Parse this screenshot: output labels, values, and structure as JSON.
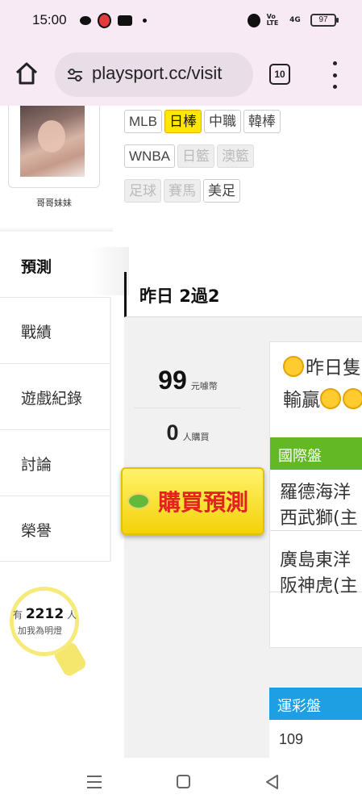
{
  "status_bar": {
    "time": "15:00",
    "volte": "Vo LTE",
    "signal": "4G",
    "battery": "97",
    "icons": [
      "message-icon",
      "app-icon",
      "youtube-icon",
      "dot-icon",
      "alarm-icon",
      "volte-icon",
      "signal-icon",
      "battery-icon"
    ]
  },
  "browser": {
    "url": "playsport.cc/visit",
    "tab_count": "10",
    "icons": [
      "home-icon",
      "site-settings-icon",
      "tabs-icon",
      "more-icon"
    ]
  },
  "profile": {
    "username": "哥哥妹妹"
  },
  "sidebar": {
    "active_item": "預測",
    "items": [
      {
        "label": "戰績"
      },
      {
        "label": "遊戲紀錄"
      },
      {
        "label": "討論"
      },
      {
        "label": "榮譽"
      }
    ],
    "bulb": {
      "prefix": "有",
      "count": "2212",
      "suffix": "人",
      "caption": "加我為明燈"
    }
  },
  "league_tags": {
    "rows": [
      [
        {
          "label": "MLB",
          "state": "normal"
        },
        {
          "label": "日棒",
          "state": "active"
        },
        {
          "label": "中職",
          "state": "normal"
        },
        {
          "label": "韓棒",
          "state": "normal"
        }
      ],
      [
        {
          "label": "WNBA",
          "state": "normal"
        },
        {
          "label": "日籃",
          "state": "disabled"
        },
        {
          "label": "澳籃",
          "state": "disabled"
        }
      ],
      [
        {
          "label": "足球",
          "state": "disabled"
        },
        {
          "label": "賽馬",
          "state": "disabled"
        },
        {
          "label": "美足",
          "state": "normal"
        }
      ]
    ]
  },
  "record": {
    "heading": "昨日 2過2",
    "price_value": "99",
    "price_unit": "元噱幣",
    "buyers_value": "0",
    "buyers_unit": "人購買",
    "buy_button": "購買預測"
  },
  "preview": {
    "line1": "昨日隻",
    "line2": "輸贏",
    "intl_section": "國際盤",
    "games": [
      {
        "line1": "羅德海洋",
        "line2": "西武獅(主"
      },
      {
        "line1": "廣島東洋",
        "line2": "阪神虎(主"
      }
    ],
    "lottery_section": "運彩盤",
    "lottery_number": "109"
  },
  "colors": {
    "active_tag": "#ffe800",
    "intl_section": "#63b826",
    "lottery_section": "#1e9fe3",
    "buy_text": "#e3211f",
    "buy_button": "#f4d10a"
  }
}
